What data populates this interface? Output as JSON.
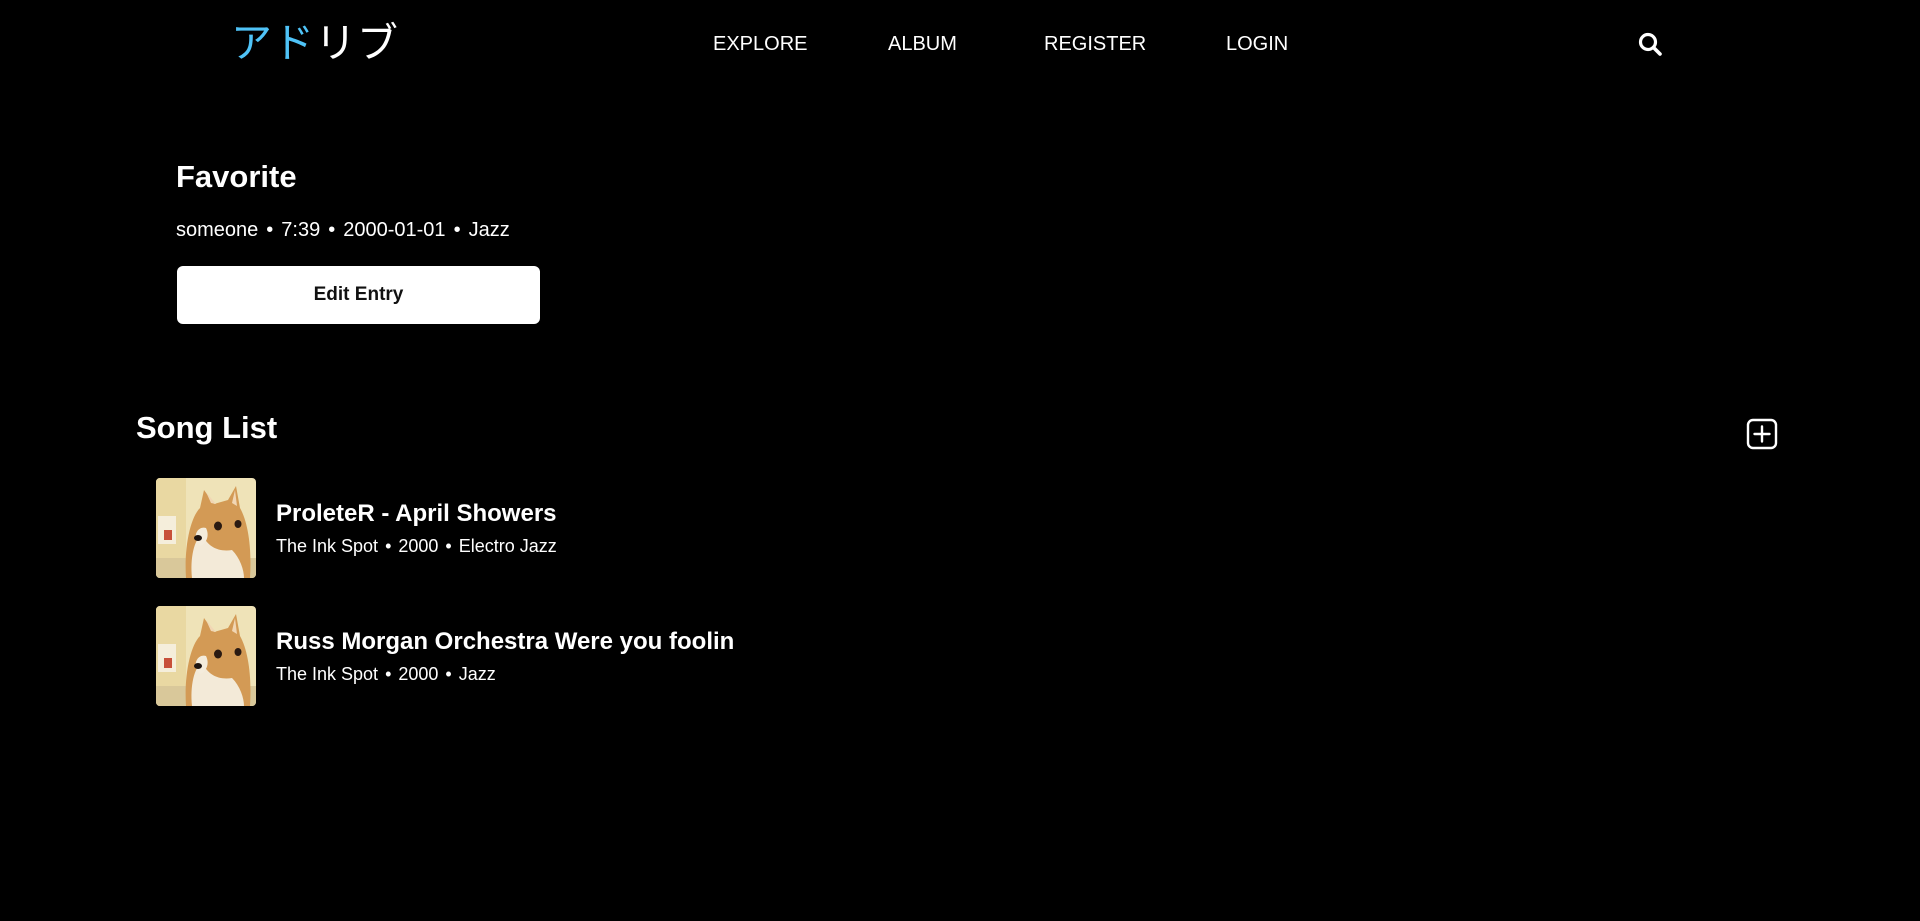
{
  "header": {
    "logo": [
      "ア",
      "ド",
      "リ",
      "ブ"
    ],
    "logo_colors": [
      "#4fc3f7",
      "#4fc3f7",
      "#ffffff",
      "#ffffff"
    ],
    "nav": [
      "EXPLORE",
      "ALBUM",
      "REGISTER",
      "LOGIN"
    ],
    "search_icon": "search-icon"
  },
  "entry": {
    "title": "Favorite",
    "author": "someone",
    "duration": "7:39",
    "date": "2000-01-01",
    "genre": "Jazz",
    "separator": "•",
    "edit_label": "Edit Entry"
  },
  "song_list": {
    "title": "Song List",
    "add_icon": "plus-square-icon",
    "songs": [
      {
        "title": "ProleteR - April Showers",
        "artist": "The Ink Spot",
        "year": "2000",
        "genre": "Electro Jazz",
        "thumbnail": "shiba-inu-dog-image"
      },
      {
        "title": "Russ Morgan Orchestra Were you foolin",
        "artist": "The Ink Spot",
        "year": "2000",
        "genre": "Jazz",
        "thumbnail": "shiba-inu-dog-image"
      }
    ]
  },
  "colors": {
    "background": "#000000",
    "text": "#ffffff",
    "accent": "#4fc3f7",
    "button_bg": "#ffffff",
    "button_text": "#111111"
  }
}
